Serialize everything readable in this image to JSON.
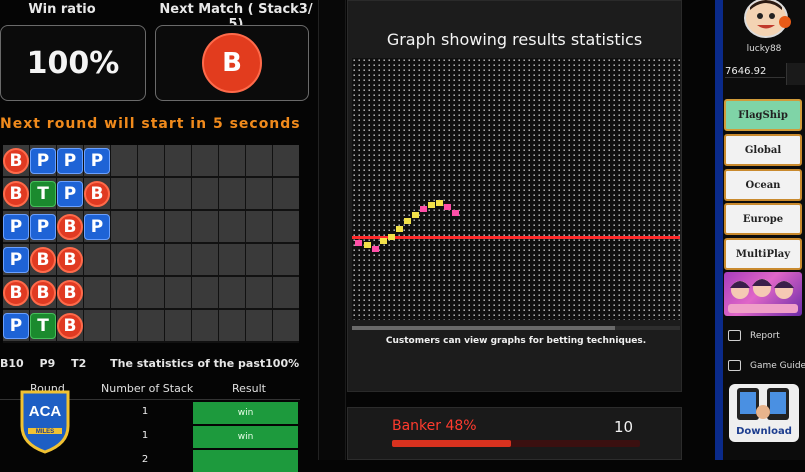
{
  "stats": {
    "win_ratio_label": "Win ratio",
    "win_ratio_value": "100%",
    "next_match_label": "Next Match ( Stack3/ 5)",
    "next_match_result": "B",
    "next_round_text": "Next round will start in 5 seconds"
  },
  "road_grid": {
    "columns": [
      [
        "B",
        "B",
        "P",
        "P",
        "B",
        "P"
      ],
      [
        "P",
        "T",
        "P",
        "B",
        "B",
        "T"
      ],
      [
        "P",
        "P",
        "B",
        "B",
        "B",
        "B"
      ],
      [
        "P",
        "B",
        "P",
        "",
        "",
        ""
      ]
    ],
    "total_columns": 11,
    "total_rows": 6
  },
  "summary": {
    "banker": "B10",
    "player": "P9",
    "tie": "T2",
    "caption": "The statistics of the past100%"
  },
  "results_table": {
    "headers": [
      "Round",
      "Number of Stack",
      "Result"
    ],
    "rows": [
      {
        "stack": "1",
        "result": "win"
      },
      {
        "stack": "1",
        "result": "win"
      },
      {
        "stack": "2",
        "result": ""
      }
    ]
  },
  "logo": {
    "text": "ACA",
    "subtext": "MILES"
  },
  "graph": {
    "title": "Graph showing results statistics",
    "caption": "Customers can view graphs for betting techniques.",
    "colors": {
      "line": "#ff2a2a",
      "marker_a": "#ff4fa8",
      "marker_b": "#f3e24a"
    }
  },
  "banker_bar": {
    "label": "Banker 48%",
    "percent": 48,
    "count": "10"
  },
  "user": {
    "name": "lucky88",
    "balance": "7646.92"
  },
  "rooms": [
    {
      "label": "FlagShip",
      "active": true
    },
    {
      "label": "Global",
      "active": false
    },
    {
      "label": "Ocean",
      "active": false
    },
    {
      "label": "Europe",
      "active": false
    },
    {
      "label": "MultiPlay",
      "active": false
    }
  ],
  "side_links": {
    "report": "Report",
    "game_guide": "Game Guide",
    "download": "Download"
  },
  "icons": {
    "avatar": "avatar-icon",
    "report": "report-icon",
    "guide": "guide-icon",
    "download": "download-icon"
  }
}
